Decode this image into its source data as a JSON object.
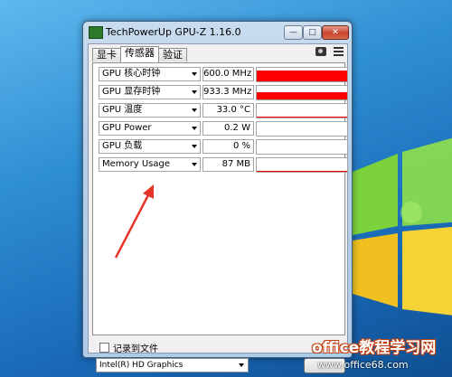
{
  "window": {
    "title": "TechPowerUp GPU-Z 1.16.0",
    "minimize_glyph": "—",
    "maximize_glyph": "□",
    "close_glyph": "✕"
  },
  "tabs": [
    {
      "label": "显卡",
      "active": false
    },
    {
      "label": "传感器",
      "active": true
    },
    {
      "label": "验证",
      "active": false
    }
  ],
  "toolbar": {
    "icons": [
      "camera-icon",
      "menu-icon"
    ]
  },
  "sensors": [
    {
      "label": "GPU 核心时钟",
      "value": "600.0 MHz",
      "graph_level": 0.8
    },
    {
      "label": "GPU 显存时钟",
      "value": "933.3 MHz",
      "graph_level": 0.55
    },
    {
      "label": "GPU 温度",
      "value": "33.0 °C",
      "graph_level": 0.1
    },
    {
      "label": "GPU Power",
      "value": "0.2 W",
      "graph_level": 0
    },
    {
      "label": "GPU 负载",
      "value": "0 %",
      "graph_level": 0
    },
    {
      "label": "Memory Usage",
      "value": "87 MB",
      "graph_level": 0.07
    }
  ],
  "log_to_file": {
    "label": "记录到文件",
    "checked": false
  },
  "gpu_select": {
    "selected": "Intel(R) HD Graphics"
  },
  "colors": {
    "graph": "#ff0000",
    "annotation_arrow": "#e8352a"
  },
  "watermark": {
    "title": "office教程学习网",
    "url": "www.office68.com"
  }
}
